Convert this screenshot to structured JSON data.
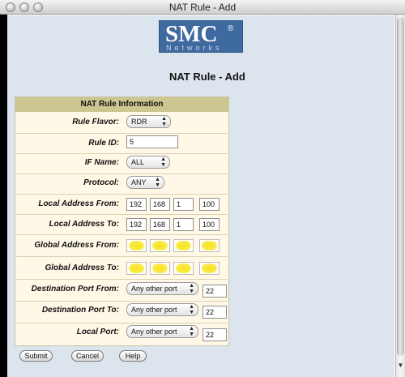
{
  "window": {
    "title": "NAT Rule - Add"
  },
  "logo": {
    "text": "SMC",
    "reg": "®",
    "sub": "Networks"
  },
  "page": {
    "title": "NAT Rule - Add"
  },
  "panel": {
    "header": "NAT Rule Information",
    "rows": {
      "flavor": {
        "label": "Rule Flavor:",
        "value": "RDR"
      },
      "rule_id": {
        "label": "Rule ID:",
        "value": "5"
      },
      "if_name": {
        "label": "IF Name:",
        "value": "ALL"
      },
      "protocol": {
        "label": "Protocol:",
        "value": "ANY"
      },
      "local_from": {
        "label": "Local Address From:",
        "octets": [
          "192",
          "168",
          "1",
          "100"
        ]
      },
      "local_to": {
        "label": "Local Address To:",
        "octets": [
          "192",
          "168",
          "1",
          "100"
        ]
      },
      "global_from": {
        "label": "Global Address From:",
        "octets": [
          "",
          "",
          "",
          ""
        ]
      },
      "global_to": {
        "label": "Global Address To:",
        "octets": [
          "",
          "",
          "",
          ""
        ]
      },
      "dest_from": {
        "label": "Destination Port From:",
        "select": "Any other port",
        "port": "22"
      },
      "dest_to": {
        "label": "Destination Port To:",
        "select": "Any other port",
        "port": "22"
      },
      "local_port": {
        "label": "Local Port:",
        "select": "Any other port",
        "port": "22"
      }
    }
  },
  "buttons": {
    "submit": "Submit",
    "cancel": "Cancel",
    "help": "Help"
  },
  "colors": {
    "background": "#dce5ee",
    "panel": "#fff8e6",
    "header": "#ccc690",
    "logo": "#3f6aa0",
    "redaction": "#f7e21a"
  }
}
